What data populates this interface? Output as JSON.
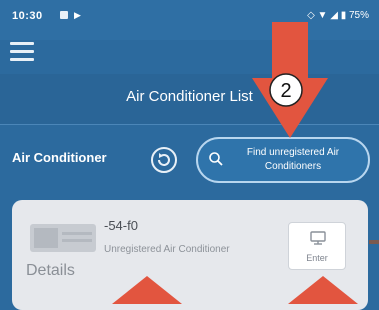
{
  "status_bar": {
    "time": "10:30",
    "right_icons": "◇ ▼ ◢ ▮ 75%"
  },
  "app": {
    "title": "Air Conditioner List"
  },
  "toolbar": {
    "ac_label": "Air Conditioner",
    "find_button_label": "Find unregistered Air Conditioners"
  },
  "device_card": {
    "details_label": "Details",
    "device_name": "-54-f0",
    "device_status": "Unregistered Air Conditioner",
    "enter_label": "Enter"
  },
  "annotation": {
    "step_number": "2"
  },
  "colors": {
    "header_blue": "#2c6a9e",
    "callout_red": "#e2553f",
    "card_bg": "#e6e8ec"
  }
}
